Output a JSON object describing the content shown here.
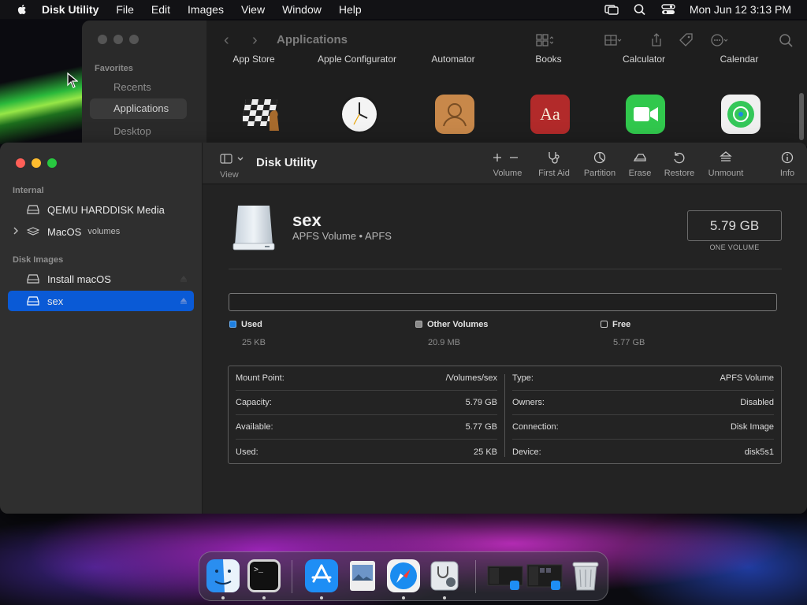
{
  "menubar": {
    "app_name": "Disk Utility",
    "menus": [
      "File",
      "Edit",
      "Images",
      "View",
      "Window",
      "Help"
    ],
    "datetime": "Mon Jun 12  3:13 PM"
  },
  "finder": {
    "title": "Applications",
    "favorites_header": "Favorites",
    "sidebar": [
      "Recents",
      "Applications",
      "Desktop"
    ],
    "apps": [
      "App Store",
      "Apple Configurator",
      "Automator",
      "Books",
      "Calculator",
      "Calendar"
    ]
  },
  "disk_utility": {
    "toolbar": {
      "view_label": "View",
      "title": "Disk Utility",
      "tools": [
        "Volume",
        "First Aid",
        "Partition",
        "Erase",
        "Restore",
        "Unmount",
        "Info"
      ]
    },
    "sidebar": {
      "internal_header": "Internal",
      "disk_images_header": "Disk Images",
      "items": [
        {
          "label": "QEMU HARDDISK Media"
        },
        {
          "label": "MacOS",
          "sub": "volumes"
        },
        {
          "label": "Install macOS"
        },
        {
          "label": "sex"
        }
      ]
    },
    "volume": {
      "name": "sex",
      "subtitle": "APFS Volume • APFS",
      "size": "5.79 GB",
      "size_caption": "ONE VOLUME"
    },
    "usage": {
      "used_fraction": 1e-05,
      "legend": [
        {
          "name": "Used",
          "value": "25 KB",
          "color": "#1e7fe0"
        },
        {
          "name": "Other Volumes",
          "value": "20.9 MB",
          "color": "#8a8a8a"
        },
        {
          "name": "Free",
          "value": "5.77 GB",
          "color": "#1f1f1f"
        }
      ]
    },
    "info": {
      "left": [
        {
          "label": "Mount Point:",
          "value": "/Volumes/sex"
        },
        {
          "label": "Capacity:",
          "value": "5.79 GB"
        },
        {
          "label": "Available:",
          "value": "5.77 GB"
        },
        {
          "label": "Used:",
          "value": "25 KB"
        }
      ],
      "right": [
        {
          "label": "Type:",
          "value": "APFS Volume"
        },
        {
          "label": "Owners:",
          "value": "Disabled"
        },
        {
          "label": "Connection:",
          "value": "Disk Image"
        },
        {
          "label": "Device:",
          "value": "disk5s1"
        }
      ]
    }
  },
  "dock": {
    "apps": [
      "finder-icon",
      "terminal-icon",
      "app-store-icon",
      "preview-icon",
      "safari-icon",
      "disk-utility-icon",
      "window-thumbnail",
      "window-thumbnail",
      "trash-icon"
    ]
  },
  "colors": {
    "accent": "#0a5ad6",
    "close": "#ff5f57",
    "minimize": "#febc2e",
    "zoom": "#28c840"
  }
}
